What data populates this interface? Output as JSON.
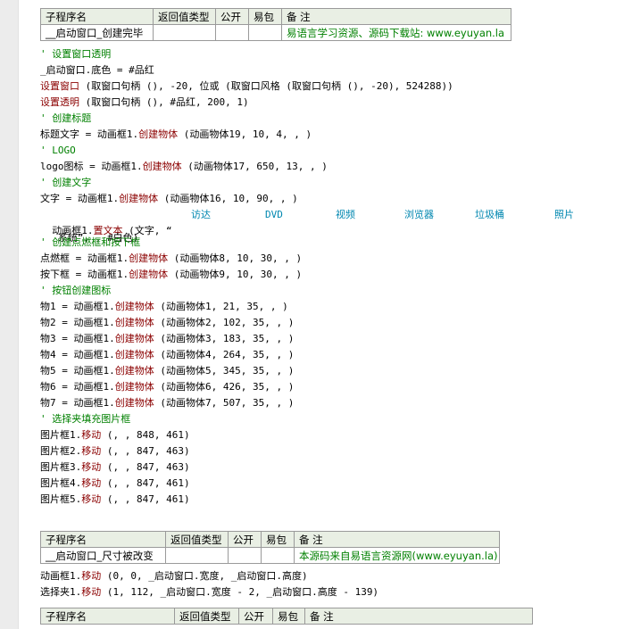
{
  "table_headers": [
    "子程序名",
    "返回值类型",
    "公开",
    "易包",
    "备 注"
  ],
  "sub1": {
    "name": "__启动窗口_创建完毕",
    "remark": "易语言学习资源、源码下载站: www.eyuyan.la"
  },
  "code1": [
    {
      "t": "cm",
      "text": "' 设置窗口透明"
    },
    {
      "t": "code",
      "parts": [
        [
          "n",
          "_启动窗口.底色 = #品红"
        ]
      ]
    },
    {
      "t": "code",
      "parts": [
        [
          "f",
          "设置窗口"
        ],
        [
          "n",
          " (取窗口句柄 (), -20, 位或 (取窗口风格 (取窗口句柄 (), -20), 524288))"
        ]
      ]
    },
    {
      "t": "code",
      "parts": [
        [
          "f",
          "设置透明"
        ],
        [
          "n",
          " (取窗口句柄 (), #品红, 200, 1)"
        ]
      ]
    },
    {
      "t": "cm",
      "text": "' 创建标题"
    },
    {
      "t": "code",
      "parts": [
        [
          "n",
          "标题文字 = 动画框1."
        ],
        [
          "f",
          "创建物体"
        ],
        [
          "n",
          " (动画物体19, 10, 4, , )"
        ]
      ]
    },
    {
      "t": "cm",
      "text": "' LOGO"
    },
    {
      "t": "code",
      "parts": [
        [
          "n",
          "logo图标 = 动画框1."
        ],
        [
          "f",
          "创建物体"
        ],
        [
          "n",
          " (动画物体17, 650, 13, , )"
        ]
      ]
    },
    {
      "t": "cm",
      "text": "' 创建文字"
    },
    {
      "t": "code",
      "parts": [
        [
          "n",
          "文字 = 动画框1."
        ],
        [
          "f",
          "创建物体"
        ],
        [
          "n",
          " (动画物体16, 10, 90, , )"
        ]
      ]
    }
  ],
  "settext_line": {
    "prefix": "动画框1.",
    "fn": "置文本",
    "open": " (文字, “",
    "items": [
      "访达",
      "DVD",
      "视频",
      "浏览器",
      "垃圾桶",
      "照片"
    ],
    "line2": " 系统”, , #白色)"
  },
  "code2": [
    {
      "t": "cm",
      "text": "' 创建点燃框和按下框"
    },
    {
      "t": "code",
      "parts": [
        [
          "n",
          "点燃框 = 动画框1."
        ],
        [
          "f",
          "创建物体"
        ],
        [
          "n",
          " (动画物体8, 10, 30, , )"
        ]
      ]
    },
    {
      "t": "code",
      "parts": [
        [
          "n",
          "按下框 = 动画框1."
        ],
        [
          "f",
          "创建物体"
        ],
        [
          "n",
          " (动画物体9, 10, 30, , )"
        ]
      ]
    },
    {
      "t": "cm",
      "text": "' 按钮创建图标"
    },
    {
      "t": "code",
      "parts": [
        [
          "n",
          "物1 = 动画框1."
        ],
        [
          "f",
          "创建物体"
        ],
        [
          "n",
          " (动画物体1, 21, 35, , )"
        ]
      ]
    },
    {
      "t": "code",
      "parts": [
        [
          "n",
          "物2 = 动画框1."
        ],
        [
          "f",
          "创建物体"
        ],
        [
          "n",
          " (动画物体2, 102, 35, , )"
        ]
      ]
    },
    {
      "t": "code",
      "parts": [
        [
          "n",
          "物3 = 动画框1."
        ],
        [
          "f",
          "创建物体"
        ],
        [
          "n",
          " (动画物体3, 183, 35, , )"
        ]
      ]
    },
    {
      "t": "code",
      "parts": [
        [
          "n",
          "物4 = 动画框1."
        ],
        [
          "f",
          "创建物体"
        ],
        [
          "n",
          " (动画物体4, 264, 35, , )"
        ]
      ]
    },
    {
      "t": "code",
      "parts": [
        [
          "n",
          "物5 = 动画框1."
        ],
        [
          "f",
          "创建物体"
        ],
        [
          "n",
          " (动画物体5, 345, 35, , )"
        ]
      ]
    },
    {
      "t": "code",
      "parts": [
        [
          "n",
          "物6 = 动画框1."
        ],
        [
          "f",
          "创建物体"
        ],
        [
          "n",
          " (动画物体6, 426, 35, , )"
        ]
      ]
    },
    {
      "t": "code",
      "parts": [
        [
          "n",
          "物7 = 动画框1."
        ],
        [
          "f",
          "创建物体"
        ],
        [
          "n",
          " (动画物体7, 507, 35, , )"
        ]
      ]
    },
    {
      "t": "cm",
      "text": "' 选择夹填充图片框"
    },
    {
      "t": "code",
      "parts": [
        [
          "n",
          "图片框1."
        ],
        [
          "f",
          "移动"
        ],
        [
          "n",
          " (, , 848, 461)"
        ]
      ]
    },
    {
      "t": "code",
      "parts": [
        [
          "n",
          "图片框2."
        ],
        [
          "f",
          "移动"
        ],
        [
          "n",
          " (, , 847, 463)"
        ]
      ]
    },
    {
      "t": "code",
      "parts": [
        [
          "n",
          "图片框3."
        ],
        [
          "f",
          "移动"
        ],
        [
          "n",
          " (, , 847, 463)"
        ]
      ]
    },
    {
      "t": "code",
      "parts": [
        [
          "n",
          "图片框4."
        ],
        [
          "f",
          "移动"
        ],
        [
          "n",
          " (, , 847, 461)"
        ]
      ]
    },
    {
      "t": "code",
      "parts": [
        [
          "n",
          "图片框5."
        ],
        [
          "f",
          "移动"
        ],
        [
          "n",
          " (, , 847, 461)"
        ]
      ]
    }
  ],
  "sub2": {
    "name": "__启动窗口_尺寸被改变",
    "remark": "本源码来自易语言资源网(www.eyuyan.la)"
  },
  "code3": [
    {
      "t": "code",
      "parts": [
        [
          "n",
          "动画框1."
        ],
        [
          "f",
          "移动"
        ],
        [
          "n",
          " (0, 0, _启动窗口.宽度, _启动窗口.高度)"
        ]
      ]
    },
    {
      "t": "code",
      "parts": [
        [
          "n",
          "选择夹1."
        ],
        [
          "f",
          "移动"
        ],
        [
          "n",
          " (1, 112, _启动窗口.宽度 - 2, _启动窗口.高度 - 139)"
        ]
      ]
    }
  ],
  "sub3": {
    "name": "",
    "remark": ""
  }
}
